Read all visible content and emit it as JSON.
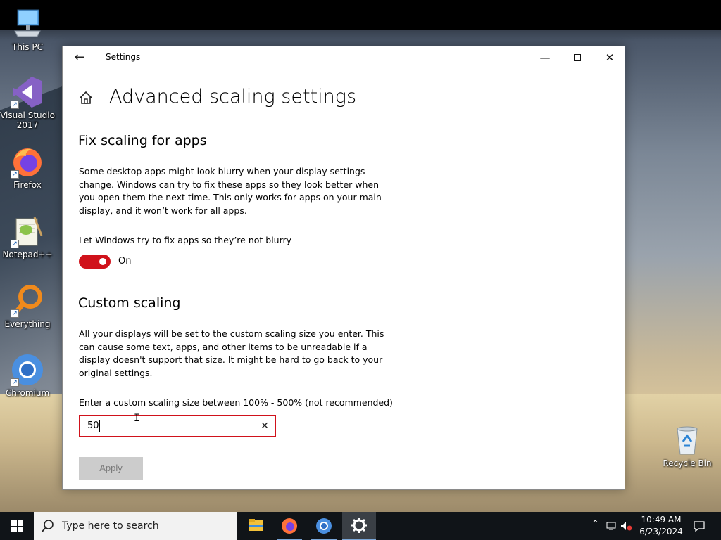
{
  "desktop": {
    "icons": [
      {
        "label": "This PC",
        "icon": "this-pc-icon"
      },
      {
        "label": "Visual Studio 2017",
        "icon": "visual-studio-icon"
      },
      {
        "label": "Firefox",
        "icon": "firefox-icon"
      },
      {
        "label": "Notepad++",
        "icon": "notepadpp-icon"
      },
      {
        "label": "Everything",
        "icon": "everything-icon"
      },
      {
        "label": "Chromium",
        "icon": "chromium-icon"
      },
      {
        "label": "Recycle Bin",
        "icon": "recycle-bin-icon"
      }
    ]
  },
  "window": {
    "app_title": "Settings",
    "back_icon": "back-arrow-icon",
    "minimize_glyph": "—",
    "close_glyph": "✕",
    "page_title": "Advanced scaling settings",
    "fix_section": {
      "title": "Fix scaling for apps",
      "description": "Some desktop apps might look blurry when your display settings change. Windows can try to fix these apps so they look better when you open them the next time. This only works for apps on your main display, and it won’t work for all apps.",
      "toggle_label": "Let Windows try to fix apps so they’re not blurry",
      "toggle_state": "On"
    },
    "custom_section": {
      "title": "Custom scaling",
      "description": "All your displays will be set to the custom scaling size you enter. This can cause some text, apps, and other items to be unreadable if a display doesn't support that size. It might be hard to go back to your original settings.",
      "input_label": "Enter a custom scaling size between 100% - 500% (not recommended)",
      "input_value": "50",
      "clear_glyph": "✕",
      "apply_label": "Apply"
    }
  },
  "taskbar": {
    "search_placeholder": "Type here to search",
    "apps": [
      "file-explorer-icon",
      "firefox-icon",
      "chromium-icon",
      "settings-gear-icon"
    ],
    "time": "10:49 AM",
    "date": "6/23/2024"
  },
  "colors": {
    "accent_red": "#d0121b",
    "taskbar": "#101418",
    "apply_disabled_bg": "#cccccc"
  }
}
